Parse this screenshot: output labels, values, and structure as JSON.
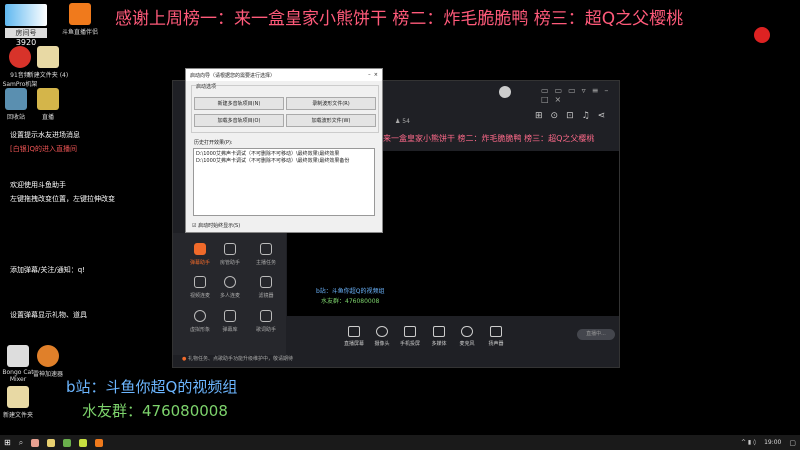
{
  "banner": "感谢上周榜一：来一盒皇家小熊饼干 榜二：炸毛脆脆鸭 榜三：超Q之父樱桃",
  "logo": {
    "room_label": "房间号",
    "room_number": "3920"
  },
  "desktop_icons": [
    {
      "label": "斗鱼直播伴侣",
      "color": "#f07a1c"
    },
    {
      "label": "91音频 SamPro机架",
      "color": "#d8332a"
    },
    {
      "label": "新建文件夹 (4)",
      "color": "#e8d9a4"
    },
    {
      "label": "回收站",
      "color": "#5a8fb0"
    },
    {
      "label": "直播",
      "color": "#d4b54a"
    },
    {
      "label": "Bongo Cat Mixer",
      "color": "#ddd"
    },
    {
      "label": "雷神加速器",
      "color": "#e0802a"
    },
    {
      "label": "新建文件夹",
      "color": "#e8d9a4"
    }
  ],
  "chat": [
    "设置提示水友进场消息",
    "[白银]Q的进入直播间",
    "欢迎使用斗鱼助手",
    "左键拖拽改变位置，左键拉伸改变",
    "添加弹幕/关注/通知：q!",
    "设置弹幕显示礼物、道具"
  ],
  "dialog": {
    "title": "启动向导（请根据您的需要进行选择）",
    "group": "启动选项",
    "buttons": [
      "新建多音轨项目(N)",
      "录制波形文件(R)",
      "加载多音轨项目(O)",
      "加载波形文件(W)"
    ],
    "list_label": "历史打开效果(P):",
    "list_items": [
      "D:\\1000艾弗声卡调试（不可删除不可移动）\\最终效果\\最终效果",
      "D:\\1000艾弗声卡调试（不可删除不可移动）\\最终效果\\最终效果备份"
    ],
    "checkbox": "启动时始终显示(S)",
    "checked": true
  },
  "app": {
    "followers": "54",
    "banner": "来一盒皇家小熊饼干 榜二：炸毛脆脆鸭 榜三：超Q之父樱桃",
    "tools": [
      "弹幕助手",
      "房管助手",
      "主播任务",
      "视频连麦",
      "多人连麦",
      "滤镜器",
      "虚拟形象",
      "弹幕库",
      "歌词助手"
    ],
    "controls": [
      "直播屏幕",
      "摄像头",
      "手机投屏",
      "多媒体",
      "麦克风",
      "扬声器"
    ],
    "live_button": "直播中...",
    "status": "礼物任务、点歌助手功能升级维护中，敬请期待"
  },
  "overlay": {
    "bilibili": "b站：斗鱼你超Q的视频组",
    "qq_group": "水友群：476080008"
  },
  "taskbar": {
    "time": "19:00"
  }
}
